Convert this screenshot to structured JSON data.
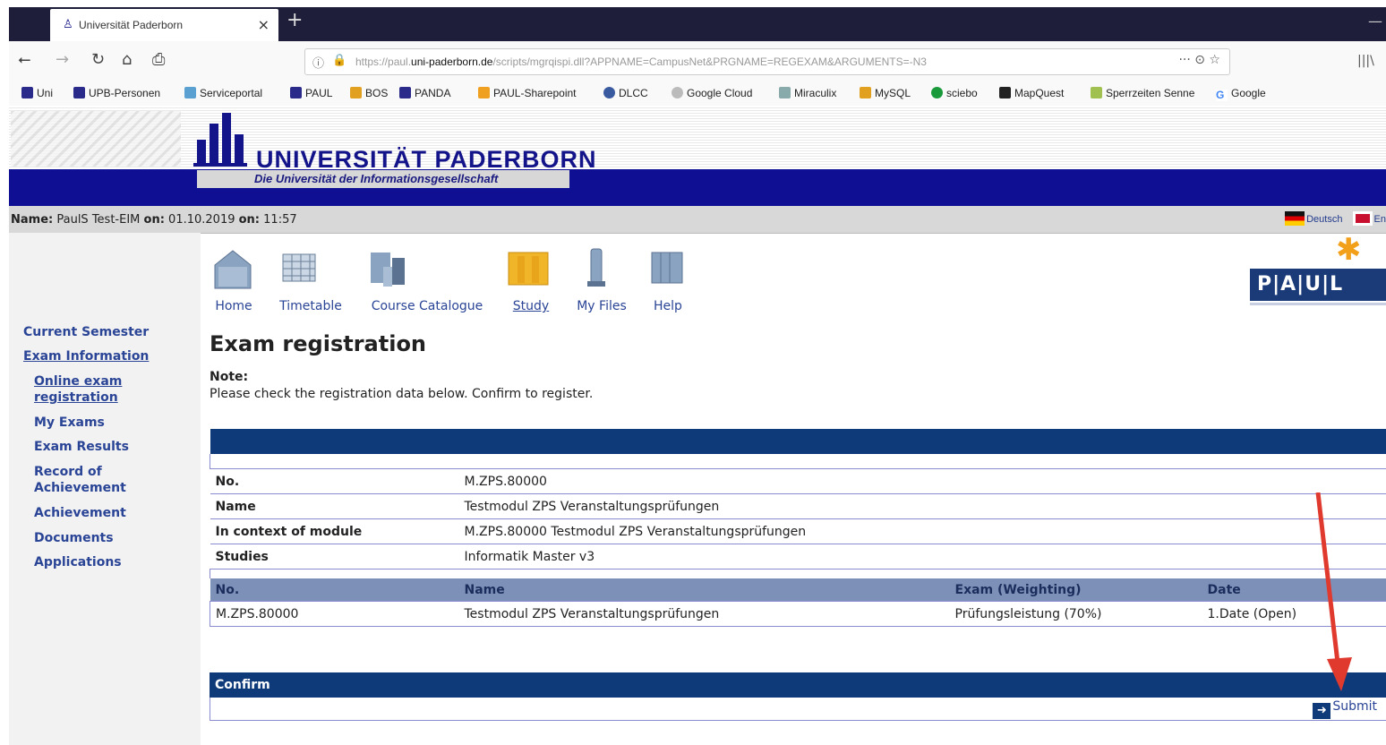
{
  "browser": {
    "tab_title": "Universität Paderborn",
    "tab_close": "×",
    "new_tab": "+",
    "url_prefix": "https://paul.",
    "url_domain": "uni-paderborn.de",
    "url_rest": "/scripts/mgrqispi.dll?APPNAME=CampusNet&PRGNAME=REGEXAM&ARGUMENTS=-N3",
    "url_actions": "···  ⊙  ☆",
    "bookmarks": [
      "Uni",
      "UPB-Personen",
      "Serviceportal",
      "PAUL",
      "BOS",
      "PANDA",
      "PAUL-Sharepoint",
      "DLCC",
      "Google Cloud",
      "Miraculix",
      "MySQL",
      "sciebo",
      "MapQuest",
      "Sperrzeiten Senne",
      "Google"
    ]
  },
  "header": {
    "university": "UNIVERSITÄT PADERBORN",
    "tagline": "Die Universität der Informationsgesellschaft",
    "name_label": "Name:",
    "name_value": "PaulS Test-EIM",
    "on_label": "on:",
    "date_value": "01.10.2019",
    "on_label2": "on:",
    "time_value": "11:57",
    "lang_de": "Deutsch",
    "lang_en": "En",
    "paul_logo": "P|A|U|L"
  },
  "topnav": [
    "Home",
    "Timetable",
    "Course Catalogue",
    "Study",
    "My Files",
    "Help"
  ],
  "sidebar": {
    "items": [
      "Current Semester",
      "Exam Information",
      "Online exam registration",
      "My Exams",
      "Exam Results",
      "Record of Achievement",
      "Achievement",
      "Documents",
      "Applications"
    ]
  },
  "main": {
    "title": "Exam registration",
    "note_label": "Note:",
    "note_text": "Please check the registration data below. Confirm to register.",
    "details": [
      {
        "key": "No.",
        "value": "M.ZPS.80000"
      },
      {
        "key": "Name",
        "value": "Testmodul ZPS Veranstaltungsprüfungen"
      },
      {
        "key": "In context of module",
        "value": "M.ZPS.80000 Testmodul ZPS Veranstaltungsprüfungen"
      },
      {
        "key": "Studies",
        "value": "Informatik Master v3"
      }
    ],
    "exam_table": {
      "headers": [
        "No.",
        "Name",
        "Exam (Weighting)",
        "Date"
      ],
      "row": [
        "M.ZPS.80000",
        "Testmodul ZPS Veranstaltungsprüfungen",
        "Prüfungsleistung (70%)",
        "1.Date (Open)"
      ]
    },
    "confirm_label": "Confirm",
    "submit_label": "Submit"
  },
  "colors": {
    "brand_blue": "#0f0f93",
    "table_header": "#0f3a7a",
    "link": "#2a4496",
    "arrow": "#e03a2f"
  }
}
